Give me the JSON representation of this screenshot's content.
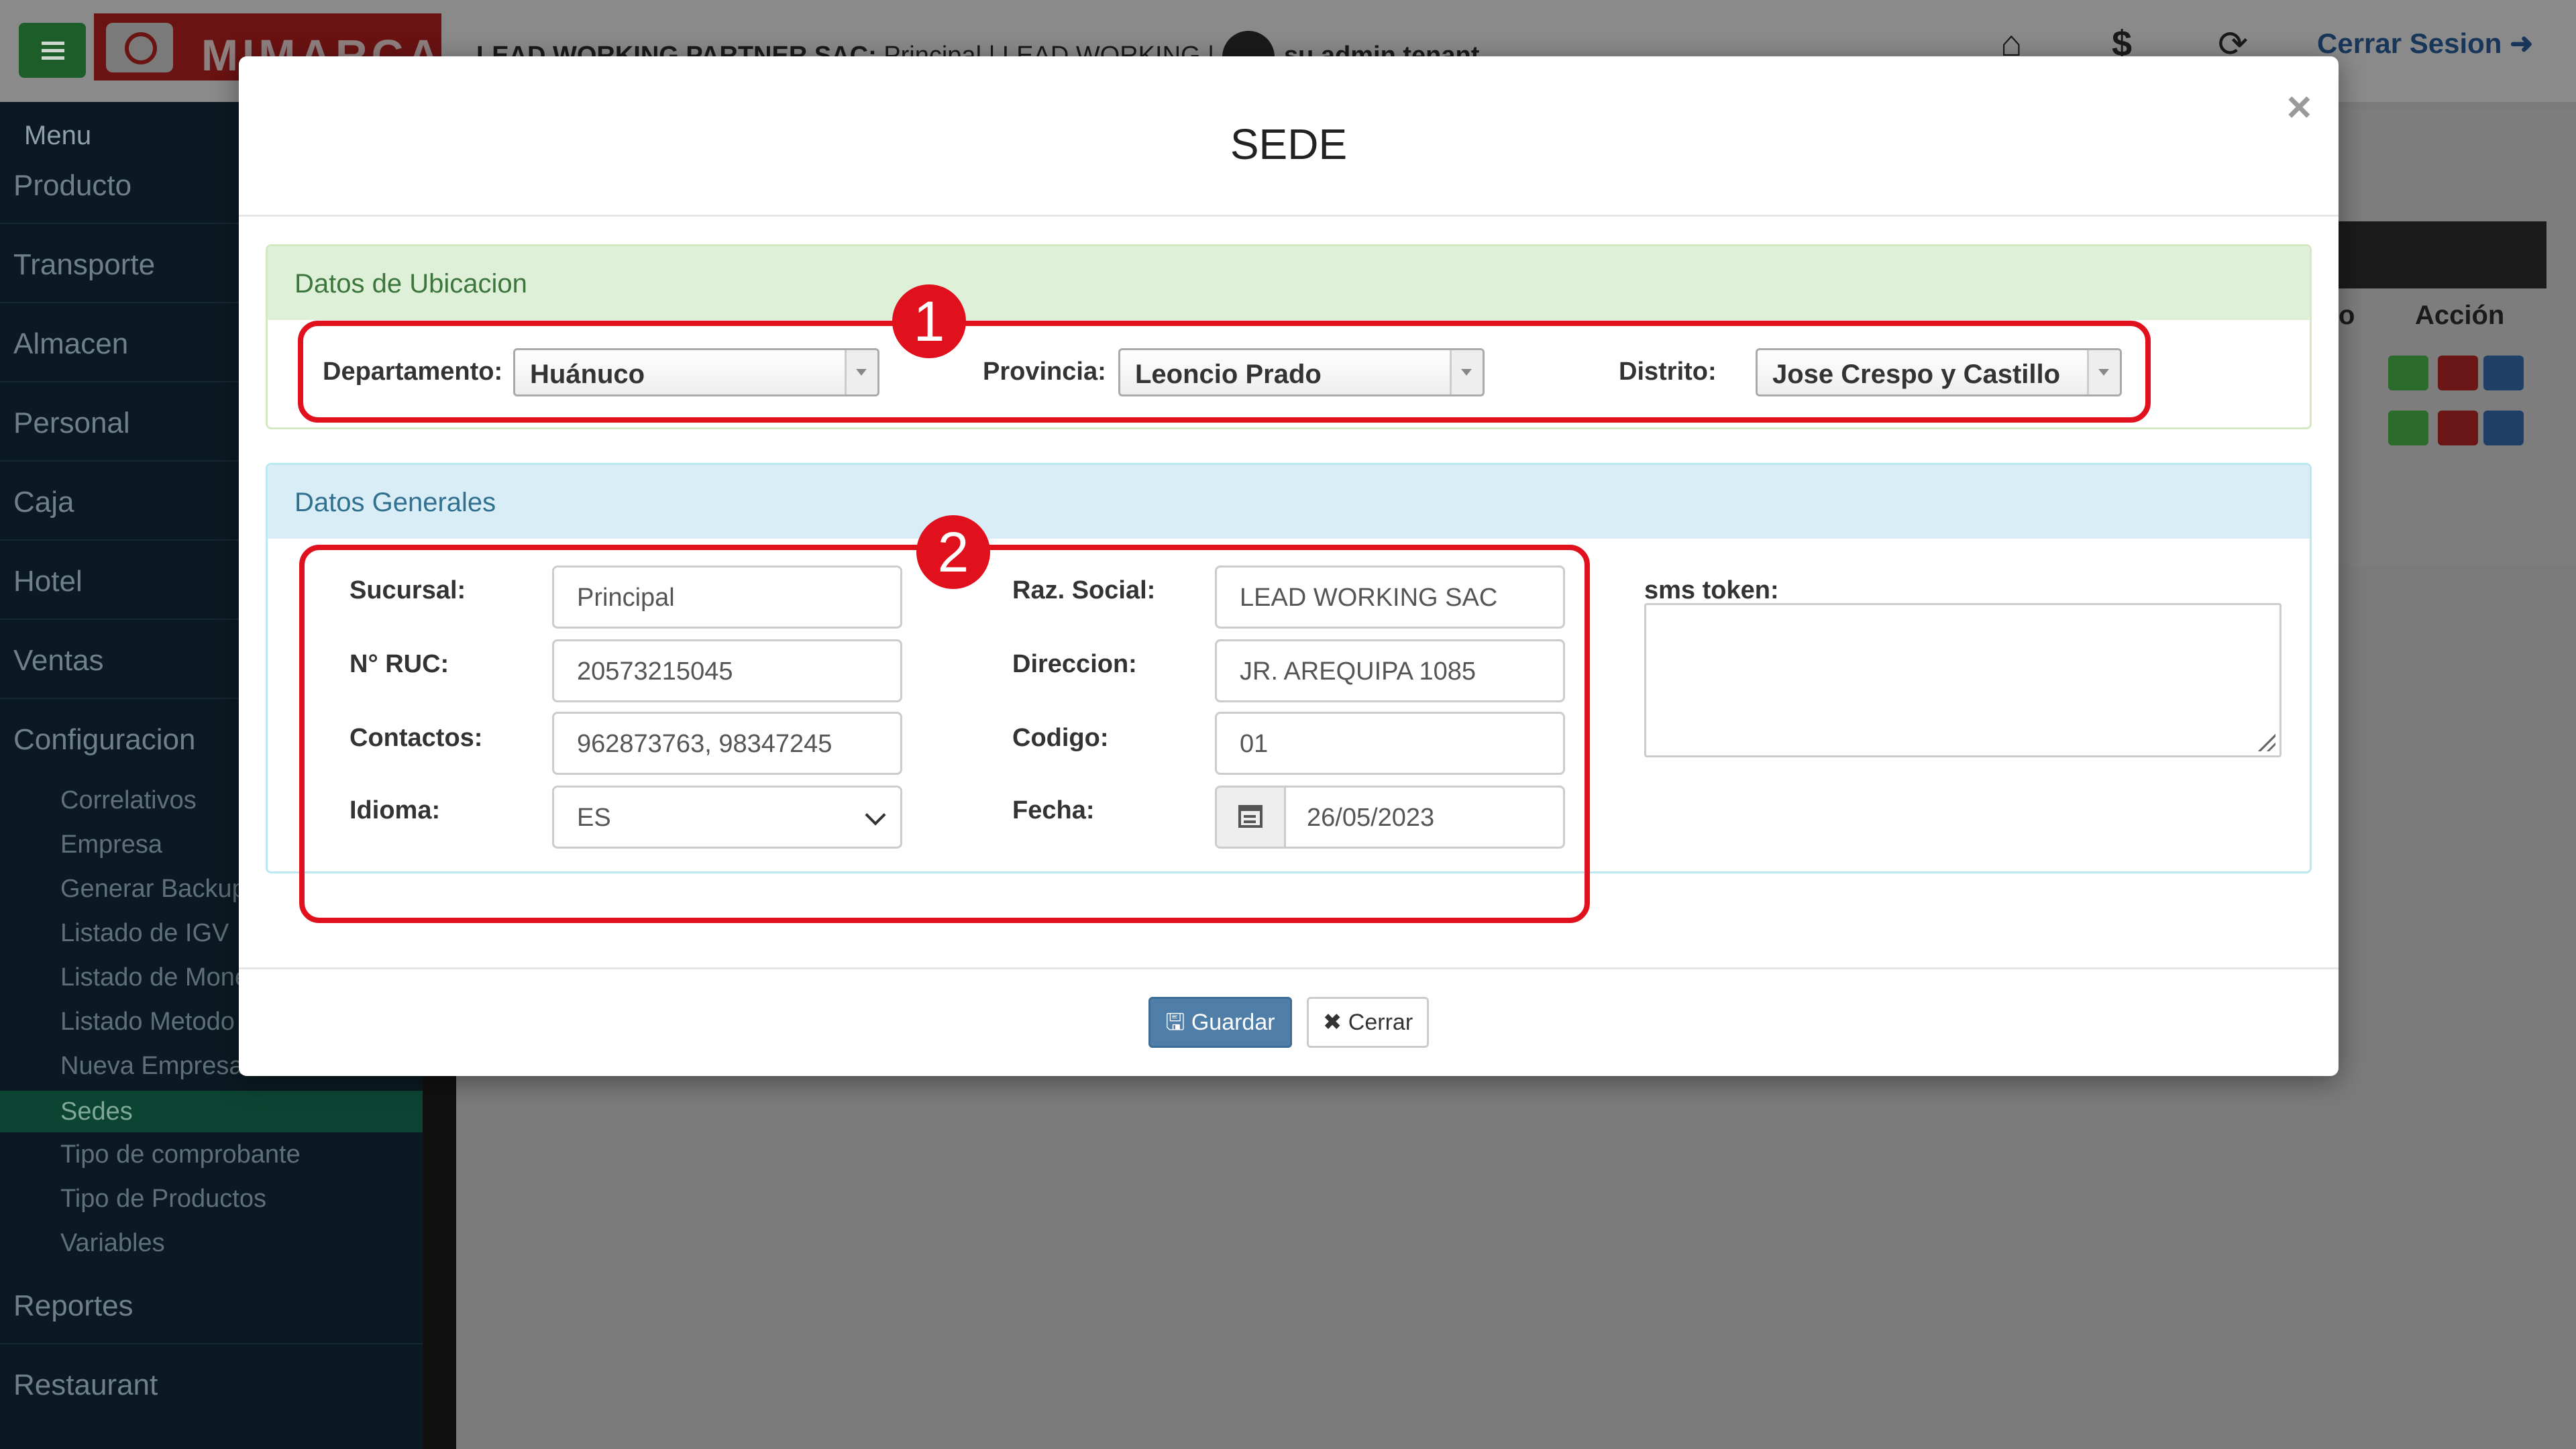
{
  "app": {
    "brand": "MIMARCA",
    "tenant_company": "LEAD WORKING PARTNER SAC:",
    "tenant_branch": " Principal | LEAD WORKING |",
    "user": "su admin tenant",
    "logout_label": "Cerrar Sesion"
  },
  "sidebar": {
    "title": "Menu",
    "items": [
      "Producto",
      "Transporte",
      "Almacen",
      "Personal",
      "Caja",
      "Hotel",
      "Ventas",
      "Configuracion"
    ],
    "subitems": [
      "Correlativos",
      "Empresa",
      "Generar Backup",
      "Listado de IGV",
      "Listado de Mone",
      "Listado Metodo",
      "Nueva Empresa",
      "Sedes",
      "Tipo de comprobante",
      "Tipo de Productos",
      "Variables"
    ],
    "active_subitem": "Sedes",
    "bottom_items": [
      "Reportes",
      "Restaurant"
    ]
  },
  "background_table": {
    "col_partial": "o",
    "col_action": "Acción"
  },
  "modal": {
    "title": "SEDE",
    "close_icon": "×",
    "ubicacion": {
      "heading": "Datos de Ubicacion",
      "departamento_label": "Departamento:",
      "departamento_value": "Huánuco",
      "provincia_label": "Provincia:",
      "provincia_value": "Leoncio Prado",
      "distrito_label": "Distrito:",
      "distrito_value": "Jose Crespo y Castillo"
    },
    "generales": {
      "heading": "Datos Generales",
      "sucursal_label": "Sucursal:",
      "sucursal_value": "Principal",
      "ruc_label": "N° RUC:",
      "ruc_value": "20573215045",
      "contactos_label": "Contactos:",
      "contactos_value": "962873763, 98347245",
      "idioma_label": "Idioma:",
      "idioma_value": "ES",
      "razon_label": "Raz. Social:",
      "razon_value": "LEAD WORKING SAC",
      "direccion_label": "Direccion:",
      "direccion_value": "JR. AREQUIPA 1085",
      "codigo_label": "Codigo:",
      "codigo_value": "01",
      "fecha_label": "Fecha:",
      "fecha_value": "26/05/2023",
      "sms_label": "sms token:",
      "sms_value": ""
    },
    "annotations": [
      "1",
      "2"
    ],
    "save_label": "Guardar",
    "close_label": "Cerrar"
  },
  "colors": {
    "highlight": "#e0101d",
    "primary_button": "#4f7ea8",
    "success_panel": "#dff0d8",
    "info_panel": "#d9edf7"
  }
}
